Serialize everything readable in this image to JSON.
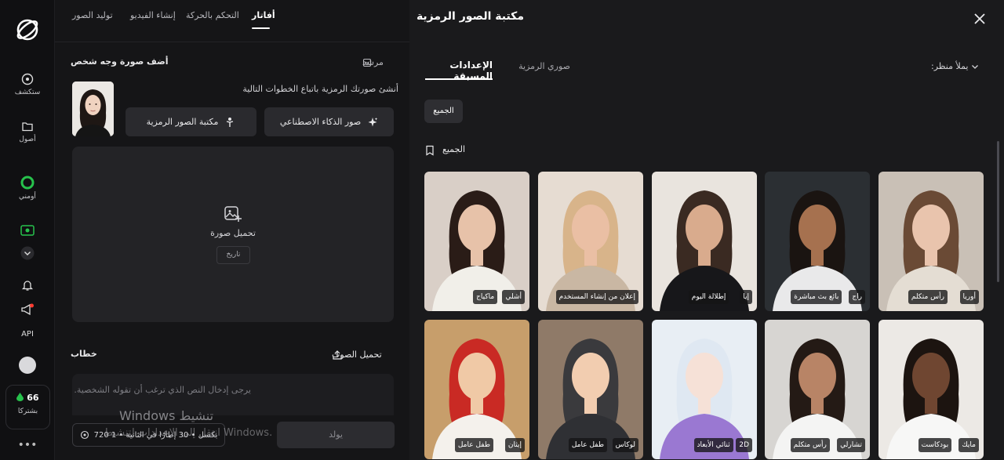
{
  "rail": {
    "items": [
      {
        "label": "ستكشف",
        "icon": "explore-icon"
      },
      {
        "label": "أصول",
        "icon": "folder-icon"
      },
      {
        "label": "أومني",
        "icon": "omni-icon"
      },
      {
        "label": "",
        "icon": "video-avatar-icon"
      },
      {
        "label": "",
        "icon": "chevron-down-icon"
      },
      {
        "label": "",
        "icon": "bell-icon"
      },
      {
        "label": "",
        "icon": "megaphone-icon"
      },
      {
        "label": "API",
        "icon": "api-icon"
      }
    ],
    "credits": {
      "value": "66",
      "label": "بشتركا"
    }
  },
  "mid": {
    "tabs": [
      "أفاتار",
      "التحكم بالحركة",
      "إنشاء الفيديو",
      "توليد الصور"
    ],
    "add_face_title": "أضف صورة وجه شخص",
    "guide_label": "مرشد",
    "hint": "أنشئ صورتك الرمزية باتباع الخطوات التالية",
    "ai_images_btn": "صور الذكاء الاصطناعي",
    "library_btn": "مكتبة الصور الرمزية",
    "upload_label": "تحميل صورة",
    "history_label": "تاريخ",
    "speech_title": "خطاب",
    "upload_voice": "تحميل الصوت",
    "script_placeholder": "يرجى إدخال النص الذي ترغب أن تقوله الشخصية.",
    "settings_pill": "720 بكسل • 30 إطارًا في الثانية • 1",
    "generate_label": "يولد",
    "watermark_line1": "Windows تنشيط",
    "watermark_line2": "انتقل إلى الإعدادات لتنشيط Windows."
  },
  "panel": {
    "title": "مكتبة الصور الرمزية",
    "tab_presets": "الإعدادات المسبقة",
    "tab_mine": "صوري الرمزية",
    "view_label": "يملأ منظر:",
    "all_chip": "الجميع",
    "group_label": "الجميع",
    "cards": [
      {
        "tags": [
          "أشلي",
          "ماكياج"
        ],
        "bg": "#d9cfc7",
        "skin": "#e7c2a9",
        "hair": "#2a1c17",
        "shirt": "#f1efe9"
      },
      {
        "tags": [
          "إعلان من إنشاء المستخدم"
        ],
        "bg": "#e6dcd2",
        "skin": "#eabfa4",
        "hair": "#d8b48a",
        "shirt": "#c9b7a3"
      },
      {
        "tags": [
          "إيا",
          "إطلالة اليوم"
        ],
        "bg": "#e9e4de",
        "skin": "#d9ab8d",
        "hair": "#3a2a22",
        "shirt": "#17171a"
      },
      {
        "tags": [
          "راج",
          "بائع بث مباشرة"
        ],
        "bg": "#2b2f33",
        "skin": "#a6714f",
        "hair": "#1a1411",
        "shirt": "#e9e9ea"
      },
      {
        "tags": [
          "أوريا",
          "رأس متكلم"
        ],
        "bg": "#c9c0b6",
        "skin": "#e9c4ad",
        "hair": "#6a4a35",
        "shirt": "#e4ddd3"
      },
      {
        "tags": [
          "إيثان",
          "طفل عامل"
        ],
        "bg": "#c79e6b",
        "skin": "#f0c9a6",
        "hair": "#c92a24",
        "shirt": "#f4f1ec"
      },
      {
        "tags": [
          "لوكاس",
          "طفل عامل"
        ],
        "bg": "#8f7a68",
        "skin": "#f2cdb0",
        "hair": "#3a3a3d",
        "shirt": "#2f3034"
      },
      {
        "tags": [
          "2D",
          "ثنائي الأبعاد"
        ],
        "bg": "#e8eef4",
        "skin": "#f6e1d7",
        "hair": "#dfe8f2",
        "shirt": "#9a78d2"
      },
      {
        "tags": [
          "تشارلي",
          "رأس متكلم"
        ],
        "bg": "#d7d5d2",
        "skin": "#b88466",
        "hair": "#241a15",
        "shirt": "#f4f4f3"
      },
      {
        "tags": [
          "مايك",
          "بودكاست"
        ],
        "bg": "#ece9e5",
        "skin": "#6f4631",
        "hair": "#1c1410",
        "shirt": "#f7f7f6"
      }
    ]
  },
  "colors": {
    "accent_green": "#27c24c",
    "notify_red": "#ff3b30"
  }
}
